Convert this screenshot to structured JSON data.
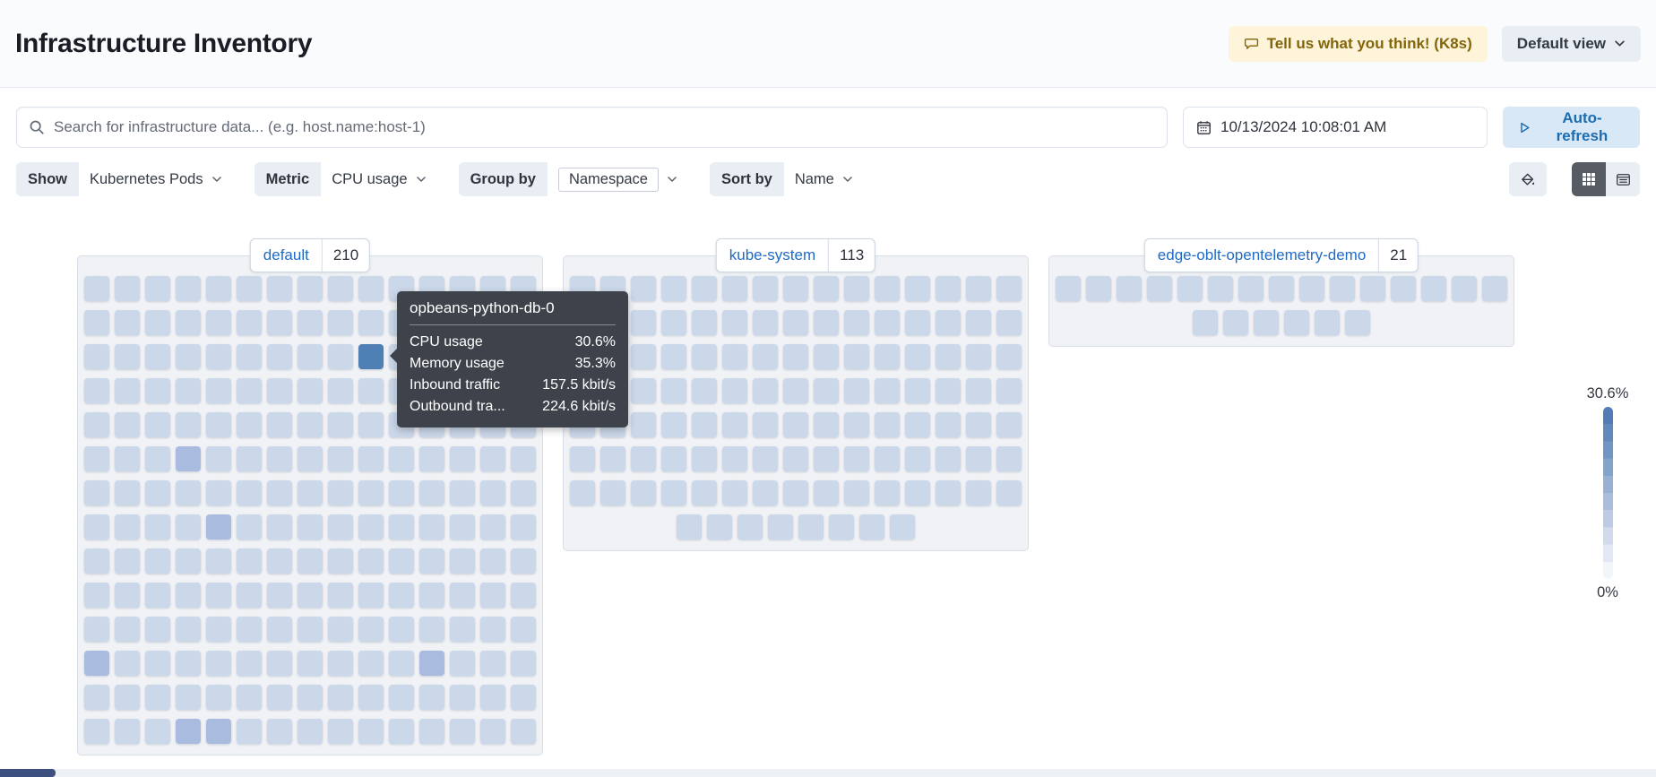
{
  "header": {
    "title": "Infrastructure Inventory",
    "feedback_button": "Tell us what you think! (K8s)",
    "view_selector": "Default view"
  },
  "toolbar": {
    "search_placeholder": "Search for infrastructure data... (e.g. host.name:host-1)",
    "datetime": "10/13/2024 10:08:01 AM",
    "auto_refresh": "Auto-refresh"
  },
  "filters": {
    "show": {
      "label": "Show",
      "value": "Kubernetes Pods"
    },
    "metric": {
      "label": "Metric",
      "value": "CPU usage"
    },
    "group_by": {
      "label": "Group by",
      "value": "Namespace"
    },
    "sort_by": {
      "label": "Sort by",
      "value": "Name"
    }
  },
  "view_controls": {
    "icons": [
      "paint-fill-icon",
      "waffle-grid-icon",
      "table-list-icon"
    ],
    "selected_view": "waffle-grid"
  },
  "groups": [
    {
      "name": "default",
      "count": "210",
      "cols": 15,
      "full_rows": 14,
      "last_row_cells": 0,
      "highlights": [
        {
          "row": 2,
          "col": 9,
          "level": "high"
        },
        {
          "row": 5,
          "col": 3,
          "level": "medium"
        },
        {
          "row": 7,
          "col": 4,
          "level": "medium"
        },
        {
          "row": 11,
          "col": 0,
          "level": "medium"
        },
        {
          "row": 11,
          "col": 11,
          "level": "medium"
        },
        {
          "row": 13,
          "col": 3,
          "level": "medium"
        },
        {
          "row": 13,
          "col": 4,
          "level": "medium"
        }
      ]
    },
    {
      "name": "kube-system",
      "count": "113",
      "cols": 15,
      "full_rows": 7,
      "last_row_cells": 8,
      "highlights": []
    },
    {
      "name": "edge-oblt-opentelemetry-demo",
      "count": "21",
      "cols": 15,
      "full_rows": 1,
      "last_row_cells": 6,
      "highlights": []
    }
  ],
  "tooltip": {
    "title": "opbeans-python-db-0",
    "rows": [
      {
        "label": "CPU usage",
        "value": "30.6%"
      },
      {
        "label": "Memory usage",
        "value": "35.3%"
      },
      {
        "label": "Inbound traffic",
        "value": "157.5 kbit/s"
      },
      {
        "label": "Outbound tra...",
        "value": "224.6 kbit/s"
      }
    ]
  },
  "legend": {
    "max_label": "30.6%",
    "min_label": "0%"
  },
  "colors": {
    "accent_link": "#1f6bc4",
    "cell_base": "#cbd8ea",
    "cell_medium": "#a9bcdf",
    "cell_high": "#4e7fb5",
    "tooltip_bg": "#3e424a",
    "warning_bg": "#fdf4d9",
    "warning_text": "#83650c",
    "refresh_bg": "#d9e8f7",
    "refresh_text": "#1c6cb0",
    "legend_top": "#527db4",
    "legend_bottom": "#f2f5fa"
  }
}
